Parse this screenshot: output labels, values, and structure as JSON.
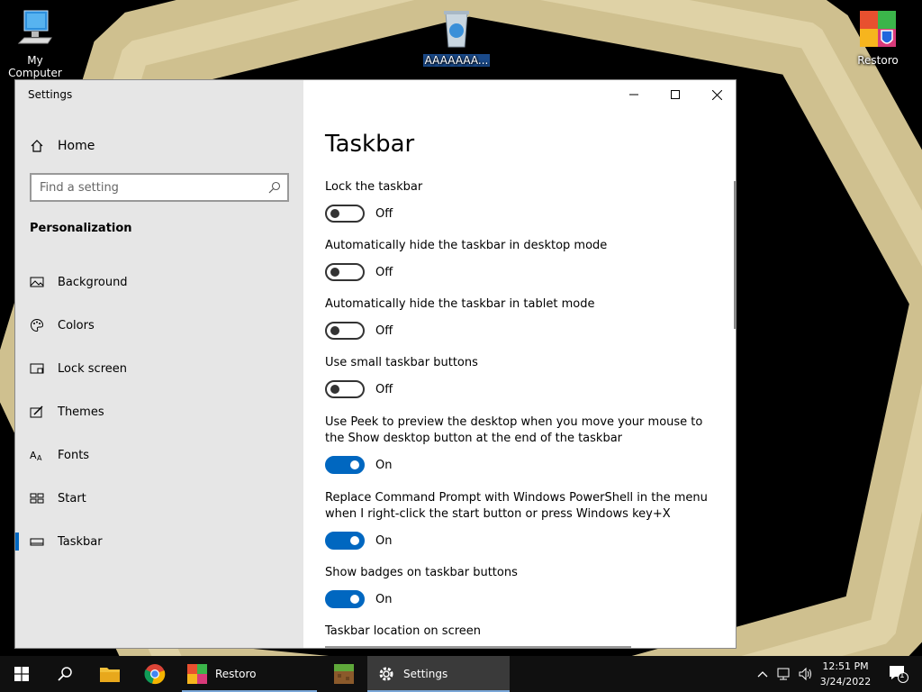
{
  "desktop": {
    "icons": [
      {
        "label": "My Computer"
      },
      {
        "label": "AAAAAAA..."
      },
      {
        "label": "Restoro"
      }
    ]
  },
  "window": {
    "title": "Settings",
    "sidebar": {
      "home_label": "Home",
      "search_placeholder": "Find a setting",
      "section_title": "Personalization",
      "items": [
        {
          "label": "Background",
          "icon": "image-icon"
        },
        {
          "label": "Colors",
          "icon": "palette-icon"
        },
        {
          "label": "Lock screen",
          "icon": "lock-screen-icon"
        },
        {
          "label": "Themes",
          "icon": "brush-icon"
        },
        {
          "label": "Fonts",
          "icon": "font-icon"
        },
        {
          "label": "Start",
          "icon": "start-layout-icon"
        },
        {
          "label": "Taskbar",
          "icon": "taskbar-icon",
          "active": true
        }
      ]
    },
    "main": {
      "title": "Taskbar",
      "settings": [
        {
          "label": "Lock the taskbar",
          "state": "Off",
          "on": false
        },
        {
          "label": "Automatically hide the taskbar in desktop mode",
          "state": "Off",
          "on": false
        },
        {
          "label": "Automatically hide the taskbar in tablet mode",
          "state": "Off",
          "on": false
        },
        {
          "label": "Use small taskbar buttons",
          "state": "Off",
          "on": false
        },
        {
          "label": "Use Peek to preview the desktop when you move your mouse to the Show desktop button at the end of the taskbar",
          "state": "On",
          "on": true
        },
        {
          "label": "Replace Command Prompt with Windows PowerShell in the menu when I right-click the start button or press Windows key+X",
          "state": "On",
          "on": true
        },
        {
          "label": "Show badges on taskbar buttons",
          "state": "On",
          "on": true
        }
      ],
      "location_label": "Taskbar location on screen"
    }
  },
  "taskbar": {
    "apps": [
      {
        "label": "Restoro"
      },
      {
        "label": "Settings"
      }
    ],
    "time": "12:51 PM",
    "date": "3/24/2022",
    "notification_count": "1"
  },
  "colors": {
    "accent": "#0067c0",
    "sidebar_bg": "#e6e6e6",
    "taskbar_bg": "#101010"
  }
}
